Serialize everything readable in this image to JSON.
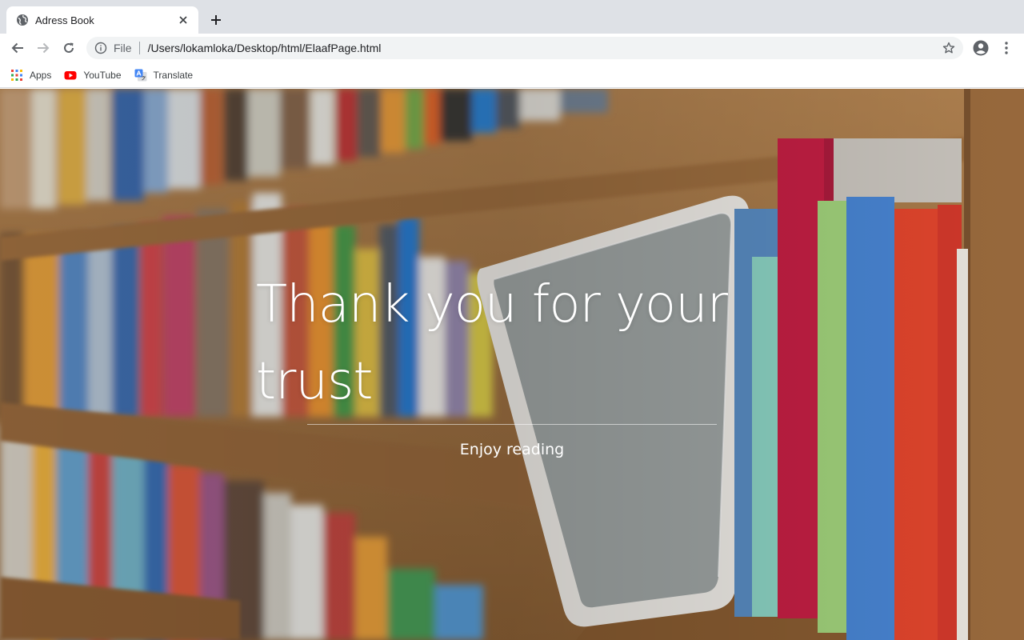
{
  "browser": {
    "tab": {
      "title": "Adress Book",
      "favicon": "globe-icon"
    },
    "new_tab_icon": "plus-icon",
    "omnibox": {
      "scheme_label": "File",
      "url": "/Users/lokamloka/Desktop/html/ElaafPage.html"
    },
    "bookmarks": [
      {
        "label": "Apps",
        "icon": "apps-grid-icon"
      },
      {
        "label": "YouTube",
        "icon": "youtube-icon"
      },
      {
        "label": "Translate",
        "icon": "google-translate-icon"
      }
    ]
  },
  "page": {
    "background": "bookshelf-photo",
    "title": "Thank you for your trust",
    "subtitle": "Enjoy reading"
  },
  "colors": {
    "tabstrip": "#dee1e6",
    "omnibox": "#f1f3f4",
    "text_white": "#ffffff"
  }
}
